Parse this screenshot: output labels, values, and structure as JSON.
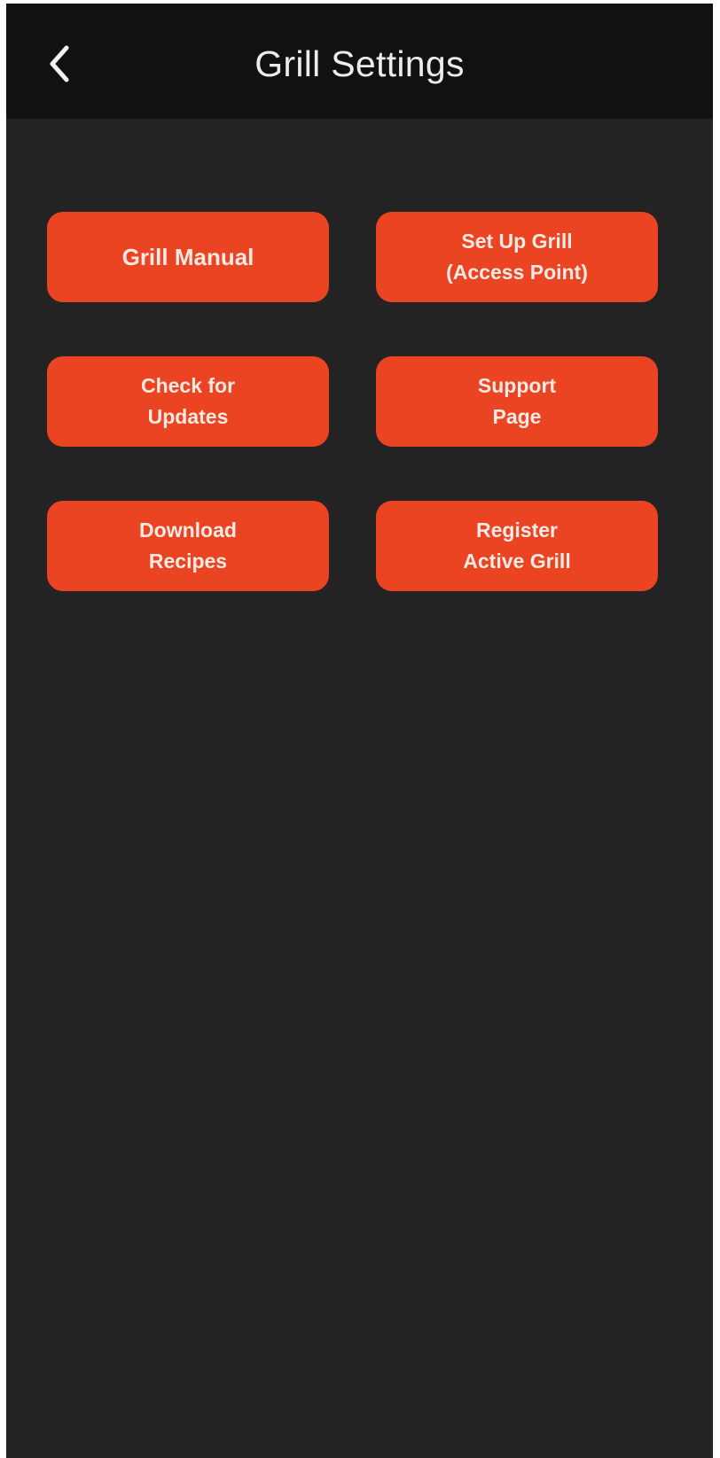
{
  "header": {
    "title": "Grill Settings",
    "back_icon": "chevron-left-icon"
  },
  "buttons": {
    "grill_manual": "Grill Manual",
    "set_up_grill": "Set Up Grill\n(Access Point)",
    "check_updates": "Check for\nUpdates",
    "support_page": "Support\nPage",
    "download_recipes": "Download\nRecipes",
    "register_grill": "Register\nActive Grill"
  },
  "colors": {
    "accent": "#ea4423",
    "background": "#232323",
    "header_background": "#111111",
    "text": "#ececec"
  }
}
